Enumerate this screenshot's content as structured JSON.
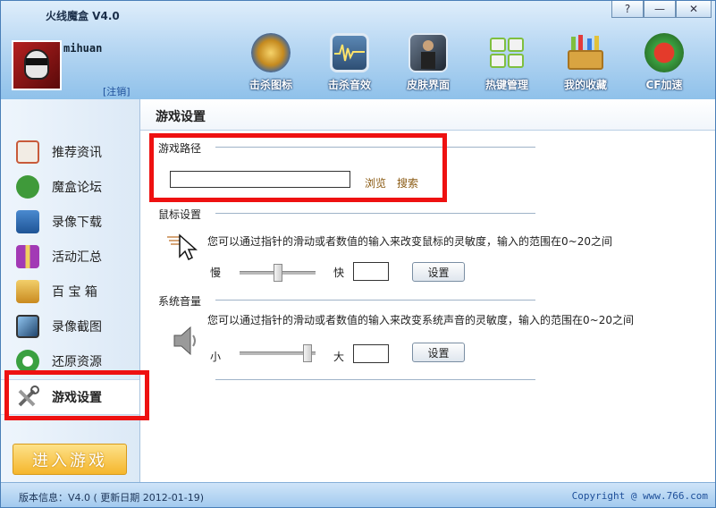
{
  "window": {
    "title": "火线魔盒 V4.0",
    "controls": [
      "?",
      "—",
      "✕"
    ]
  },
  "user": {
    "name": "mihuan",
    "logout": "[注销]"
  },
  "toolbar": [
    {
      "label": "击杀图标",
      "icon": "kill-icon-badge",
      "color": "#c58a1f"
    },
    {
      "label": "击杀音效",
      "icon": "sound-wave-monitor",
      "color": "#3a5f86"
    },
    {
      "label": "皮肤界面",
      "icon": "character-skin",
      "color": "#2f3a4a"
    },
    {
      "label": "热键管理",
      "icon": "keyboard-keys",
      "color": "#7fbf3f"
    },
    {
      "label": "我的收藏",
      "icon": "toolbox",
      "color": "#d9a441"
    },
    {
      "label": "CF加速",
      "icon": "cf-logo",
      "color": "#4aa83a"
    }
  ],
  "sidebar": {
    "items": [
      {
        "label": "推荐资讯",
        "icon": "news-icon",
        "color": "#c85a3a"
      },
      {
        "label": "魔盒论坛",
        "icon": "chat-bubble-icon",
        "color": "#3f9a3a"
      },
      {
        "label": "录像下载",
        "icon": "download-icon",
        "color": "#2f6fb5"
      },
      {
        "label": "活动汇总",
        "icon": "gift-icon",
        "color": "#a23ab5"
      },
      {
        "label": "百 宝 箱",
        "icon": "treasure-box-icon",
        "color": "#d6a030"
      },
      {
        "label": "录像截图",
        "icon": "screenshot-icon",
        "color": "#3a6fa0"
      },
      {
        "label": "还原资源",
        "icon": "restore-icon",
        "color": "#3aa040"
      },
      {
        "label": "游戏设置",
        "icon": "tools-icon",
        "color": "#7a7a7a",
        "active": true
      }
    ],
    "enter_button": "进入游戏"
  },
  "main": {
    "title": "游戏设置",
    "game_path": {
      "section": "游戏路径",
      "value": "",
      "browse": "浏览",
      "search": "搜索"
    },
    "mouse": {
      "section": "鼠标设置",
      "description": "您可以通过指针的滑动或者数值的输入来改变鼠标的灵敏度，输入的范围在0~20之间",
      "min_label": "慢",
      "max_label": "快",
      "level": 0.5,
      "value": "",
      "button": "设置"
    },
    "volume": {
      "section": "系统音量",
      "description": "您可以通过指针的滑动或者数值的输入来改变系统声音的灵敏度，输入的范围在0~20之间",
      "min_label": "小",
      "max_label": "大",
      "level": 0.95,
      "value": "",
      "button": "设置"
    }
  },
  "status": {
    "version": "版本信息：V4.0 ( 更新日期 2012-01-19)",
    "copyright": "Copyright @ www.766.com"
  },
  "highlight_color": "#ee1111"
}
